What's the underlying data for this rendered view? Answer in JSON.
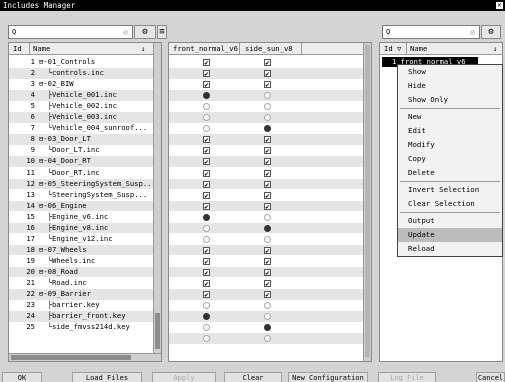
{
  "window": {
    "title": "Includes Manager",
    "close_glyph": "✕"
  },
  "left": {
    "search_placeholder": "Q",
    "col_id": "Id",
    "col_name": "Name",
    "rows": [
      {
        "id": "1",
        "name": "⊟-01_Controls"
      },
      {
        "id": "2",
        "name": "  └controls.inc"
      },
      {
        "id": "3",
        "name": "⊟-02_BIW"
      },
      {
        "id": "4",
        "name": "  ├Vehicle_001.inc"
      },
      {
        "id": "5",
        "name": "  ├Vehicle_002.inc"
      },
      {
        "id": "6",
        "name": "  ├Vehicle_003.inc"
      },
      {
        "id": "7",
        "name": "  └Vehicle_004_sunroof..."
      },
      {
        "id": "8",
        "name": "⊟-03_Door_LT"
      },
      {
        "id": "9",
        "name": "  └Door_LT.inc"
      },
      {
        "id": "10",
        "name": "⊟-04_Door_RT"
      },
      {
        "id": "11",
        "name": "  └Door_RT.inc"
      },
      {
        "id": "12",
        "name": "⊟-05_SteeringSystem_Susp..."
      },
      {
        "id": "13",
        "name": "  └SteeringSystem_Susp..."
      },
      {
        "id": "14",
        "name": "⊟-06_Engine"
      },
      {
        "id": "15",
        "name": "  ├Engine_v6.inc"
      },
      {
        "id": "16",
        "name": "  ├Engine_v8.inc"
      },
      {
        "id": "17",
        "name": "  └Engine_v12.inc"
      },
      {
        "id": "18",
        "name": "⊟-07_Wheels"
      },
      {
        "id": "19",
        "name": "  └Wheels.inc"
      },
      {
        "id": "20",
        "name": "⊟-08_Road"
      },
      {
        "id": "21",
        "name": "  └Road.inc"
      },
      {
        "id": "22",
        "name": "⊟-09_Barrier"
      },
      {
        "id": "23",
        "name": "  ├barrier.key"
      },
      {
        "id": "24",
        "name": "  ├barrier_front.key"
      },
      {
        "id": "25",
        "name": "  └side_fmvss214d.key"
      }
    ]
  },
  "mid": {
    "col1": "front_normal_v6",
    "col2": "side_sun_v8",
    "states": [
      [
        "c",
        "c"
      ],
      [
        "c",
        "c"
      ],
      [
        "c",
        "c"
      ],
      [
        "ron",
        "r"
      ],
      [
        "r",
        "r"
      ],
      [
        "r",
        "r"
      ],
      [
        "r",
        "ron"
      ],
      [
        "c",
        "c"
      ],
      [
        "c",
        "c"
      ],
      [
        "c",
        "c"
      ],
      [
        "c",
        "c"
      ],
      [
        "c",
        "c"
      ],
      [
        "c",
        "c"
      ],
      [
        "c",
        "c"
      ],
      [
        "ron",
        "r"
      ],
      [
        "r",
        "ron"
      ],
      [
        "r",
        "r"
      ],
      [
        "c",
        "c"
      ],
      [
        "c",
        "c"
      ],
      [
        "c",
        "c"
      ],
      [
        "c",
        "c"
      ],
      [
        "c",
        "c"
      ],
      [
        "r",
        "r"
      ],
      [
        "ron",
        "r"
      ],
      [
        "r",
        "ron"
      ],
      [
        "r",
        "r"
      ]
    ]
  },
  "right": {
    "search_placeholder": "Q",
    "col_id": "Id",
    "col_name": "Name",
    "selected_row": "1 front_normal_v6"
  },
  "context_menu": {
    "items": [
      "Show",
      "Hide",
      "Show Only",
      "New",
      "Edit",
      "Modify",
      "Copy",
      "Delete",
      "Invert Selection",
      "Clear Selection",
      "Output",
      "Update",
      "Reload"
    ],
    "highlighted": "Update"
  },
  "buttons": {
    "ok": "OK",
    "load_files": "Load Files",
    "apply": "Apply",
    "clear": "Clear",
    "new_config": "New Configuration",
    "log_file": "Log File",
    "cancel": "Cancel"
  },
  "icons": {
    "search": "search-icon",
    "settings": "gear-icon",
    "filter": "filter-icon",
    "sort": "sort-down-icon"
  }
}
